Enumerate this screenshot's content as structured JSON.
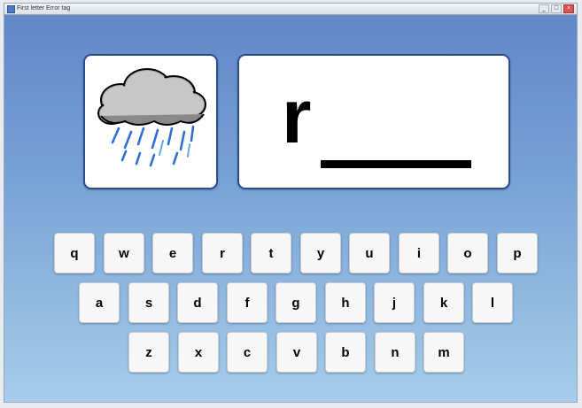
{
  "window": {
    "title": "First letter Error tag",
    "controls": {
      "minimize": "_",
      "maximize": "□",
      "close": "×"
    }
  },
  "picture": {
    "icon": "rain-cloud-icon",
    "colors": {
      "cloud": "#9a9a9a",
      "rain": "#2f6fd6"
    }
  },
  "word": {
    "letters": "r"
  },
  "keyboard": {
    "rows": [
      [
        "q",
        "w",
        "e",
        "r",
        "t",
        "y",
        "u",
        "i",
        "o",
        "p"
      ],
      [
        "a",
        "s",
        "d",
        "f",
        "g",
        "h",
        "j",
        "k",
        "l"
      ],
      [
        "z",
        "x",
        "c",
        "v",
        "b",
        "n",
        "m"
      ]
    ]
  }
}
